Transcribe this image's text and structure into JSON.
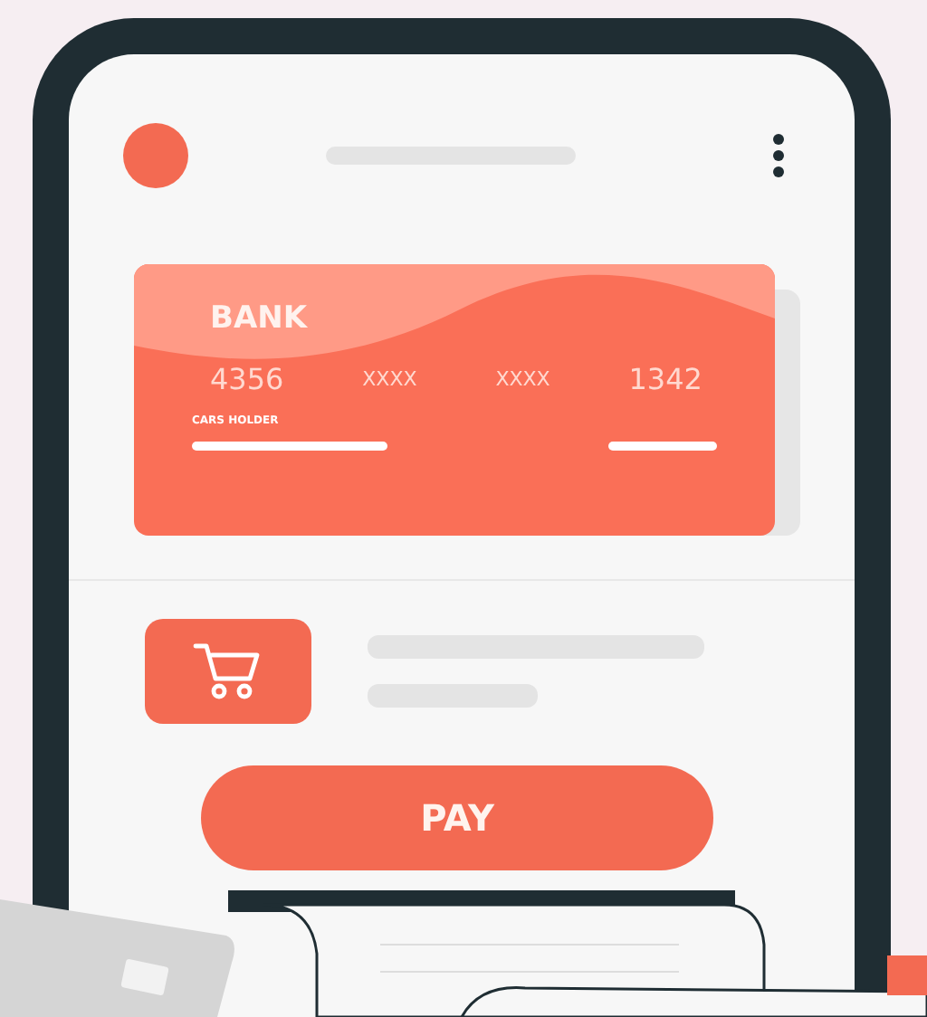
{
  "card": {
    "bank": "BANK",
    "number_groups": [
      "4356",
      "XXXX",
      "XXXX",
      "1342"
    ],
    "holder_label": "CARS HOLDER"
  },
  "pay_button": {
    "label": "PAY"
  }
}
